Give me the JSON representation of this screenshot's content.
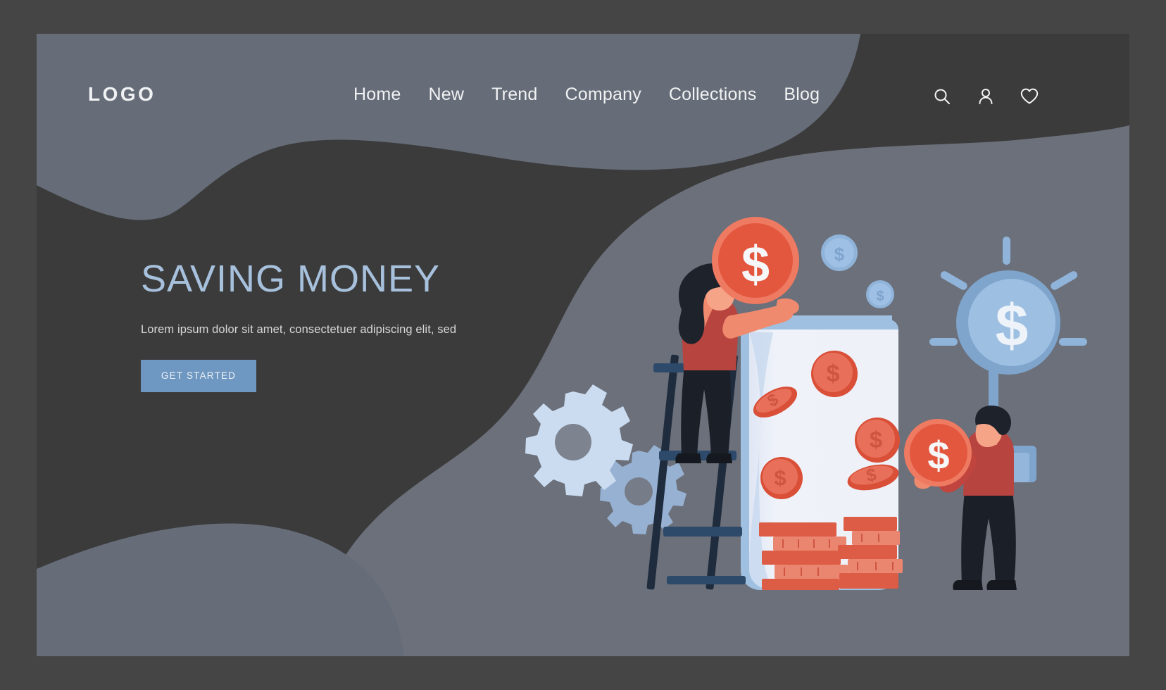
{
  "page": {
    "title": "SAVING MONEY landing page hero",
    "outer_bg": "#454545",
    "canvas_bg": "#3b3b3b",
    "blob_color": "#666d78",
    "accent_blue": "#6e97c1",
    "heading_blue": "#a7c1dd",
    "coin_red": "#e8634a",
    "coin_red_dark": "#d94f38",
    "coin_blue": "#8fb3d9",
    "jar_white": "#eef1f8",
    "shirt_red": "#c0453f",
    "hair_black": "#1d222b",
    "ladder_blue": "#2d4360"
  },
  "header": {
    "logo": "LOGO",
    "nav": [
      {
        "label": "Home"
      },
      {
        "label": "New"
      },
      {
        "label": "Trend"
      },
      {
        "label": "Company"
      },
      {
        "label": "Collections"
      },
      {
        "label": "Blog"
      }
    ],
    "icons": [
      {
        "name": "search-icon",
        "glyph": "magnifier"
      },
      {
        "name": "user-icon",
        "glyph": "person"
      },
      {
        "name": "heart-icon",
        "glyph": "heart"
      }
    ]
  },
  "hero": {
    "title": "SAVING MONEY",
    "subtitle": "Lorem ipsum dolor sit amet, consectetuer adipiscing elit, sed",
    "cta_label": "GET STARTED"
  },
  "illustration": {
    "name": "saving-money-illustration",
    "elements": [
      "woman-on-ladder-holding-coin",
      "money-jar-with-coins",
      "man-holding-coin",
      "dollar-sign-lamp",
      "gears",
      "floating-blue-coins"
    ],
    "coin_symbol": "$"
  }
}
